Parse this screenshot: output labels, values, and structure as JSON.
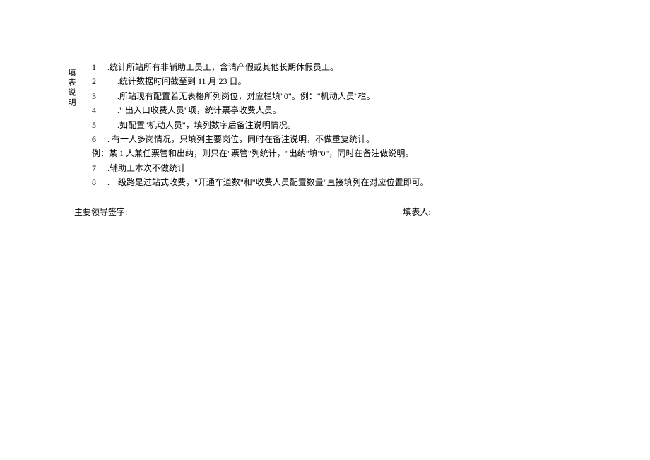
{
  "section_label": "填表说明",
  "instructions": [
    {
      "num": "1",
      "text": ".统计所站所有非辅助工员工，含请产假或其他长期休假员工。",
      "indent": "narrow"
    },
    {
      "num": "2",
      "text": ".统计数据时间截至到 11 月 23 日。",
      "indent": "wide"
    },
    {
      "num": "3",
      "text": ".所站现有配置若无表格所列岗位，对应栏填\"0\"。例：\"机动人员\"栏。",
      "indent": "wide"
    },
    {
      "num": "4",
      "text": ".\" 出入口收费人员\"项，统计票亭收费人员。",
      "indent": "wide"
    },
    {
      "num": "5",
      "text": ".如配置\"机动人员\"，填列数字后备注说明情况。",
      "indent": "wide"
    },
    {
      "num": "6",
      "text": ". 有一人多岗情况，只填列主要岗位，同时在备注说明，不做重复统计。",
      "indent": "narrow"
    }
  ],
  "example_line": "例：某 1 人兼任票管和出纳，则只在\"票管\"列统计，\"出纳\"填\"0\"，同时在备注做说明。",
  "instructions_after": [
    {
      "num": "7",
      "text": ".辅助工本次不做统计",
      "indent": "narrow"
    },
    {
      "num": "8",
      "text": ".一级路是过站式收费，\"开通车道数\"和\"收费人员配置数量\"直接填列在对应位置即可。",
      "indent": "narrow"
    }
  ],
  "signature_left": "主要领导签字:",
  "signature_right": "填表人:"
}
